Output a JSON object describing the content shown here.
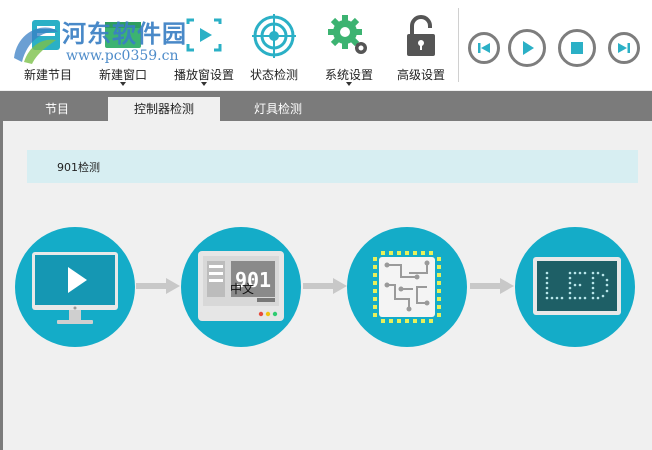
{
  "watermark": {
    "title": "河东软件园",
    "url": "www.pc0359.cn"
  },
  "toolbar": {
    "items": [
      {
        "label": "新建节目"
      },
      {
        "label": "新建窗口"
      },
      {
        "label": "播放窗设置"
      },
      {
        "label": "状态检测"
      },
      {
        "label": "系统设置"
      },
      {
        "label": "高级设置"
      }
    ],
    "player": [
      "previous",
      "play",
      "stop",
      "next"
    ]
  },
  "tabs": [
    {
      "label": "节目"
    },
    {
      "label": "控制器检测",
      "active": true
    },
    {
      "label": "灯具检测"
    }
  ],
  "panel": {
    "status_text": "901检测",
    "steps": [
      {
        "icon": "monitor-play-icon"
      },
      {
        "icon": "controller-901-icon",
        "label": "中文"
      },
      {
        "icon": "chip-icon"
      },
      {
        "icon": "led-display-icon"
      }
    ]
  },
  "colors": {
    "accent": "#14acc8",
    "icon_teal": "#2bb0c6",
    "icon_green": "#3cb371",
    "tab_bar": "#7b7b7b",
    "info_bar": "#d7eef2"
  }
}
